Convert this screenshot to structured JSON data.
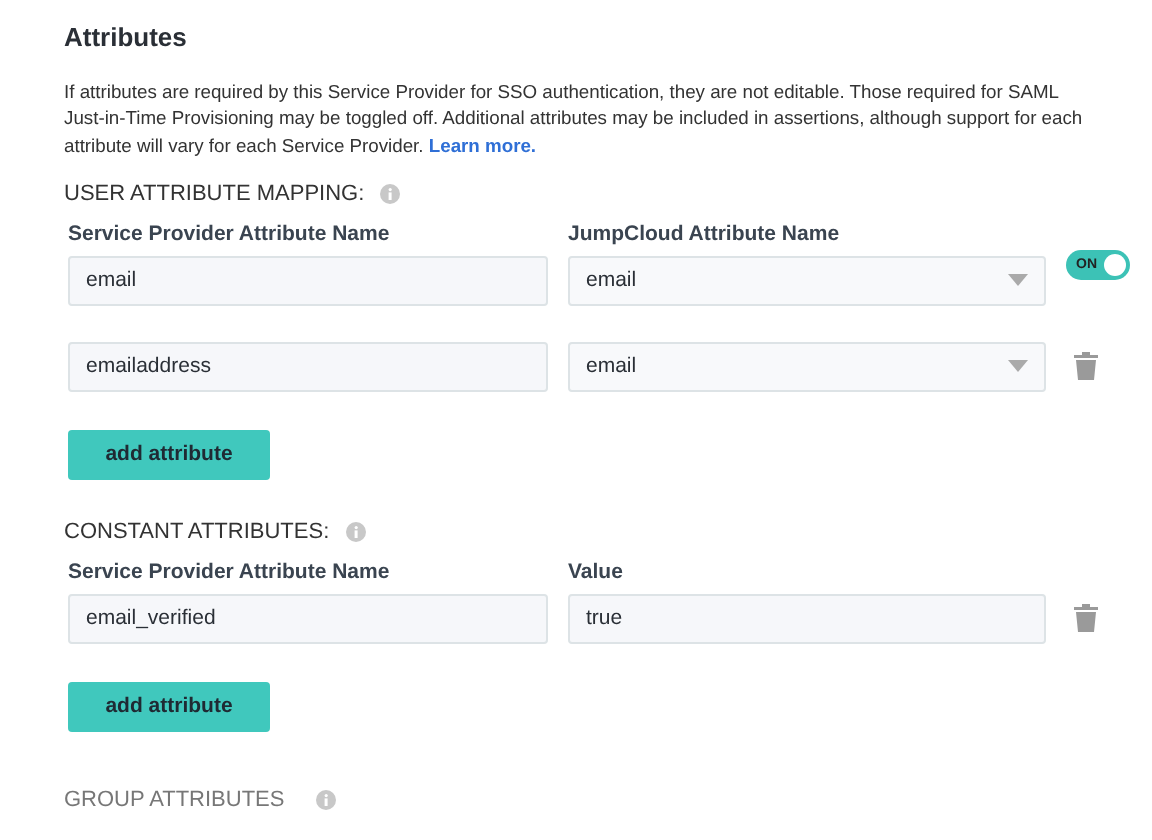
{
  "title": "Attributes",
  "description": "If attributes are required by this Service Provider for SSO authentication, they are not editable. Those required for SAML Just-in-Time Provisioning may be toggled off. Additional attributes may be included in assertions, although support for each attribute will vary for each Service Provider.",
  "learn_more": "Learn more.",
  "sections": [
    {
      "heading": "USER ATTRIBUTE MAPPING:",
      "kind": "mapping",
      "columns": [
        "Service Provider Attribute Name",
        "JumpCloud Attribute Name"
      ],
      "rows": [
        {
          "name": "email",
          "value": "email",
          "kind": "toggle",
          "toggle_label": "ON",
          "on": true
        },
        {
          "name": "emailaddress",
          "value": "email",
          "kind": "delete"
        }
      ],
      "add_button": "add attribute"
    },
    {
      "heading": "CONSTANT ATTRIBUTES:",
      "kind": "constant",
      "columns": [
        "Service Provider Attribute Name",
        "Value"
      ],
      "rows": [
        {
          "name": "email_verified",
          "value": "true",
          "kind": "delete"
        }
      ],
      "add_button": "add attribute"
    }
  ],
  "group_heading": "GROUP ATTRIBUTES"
}
